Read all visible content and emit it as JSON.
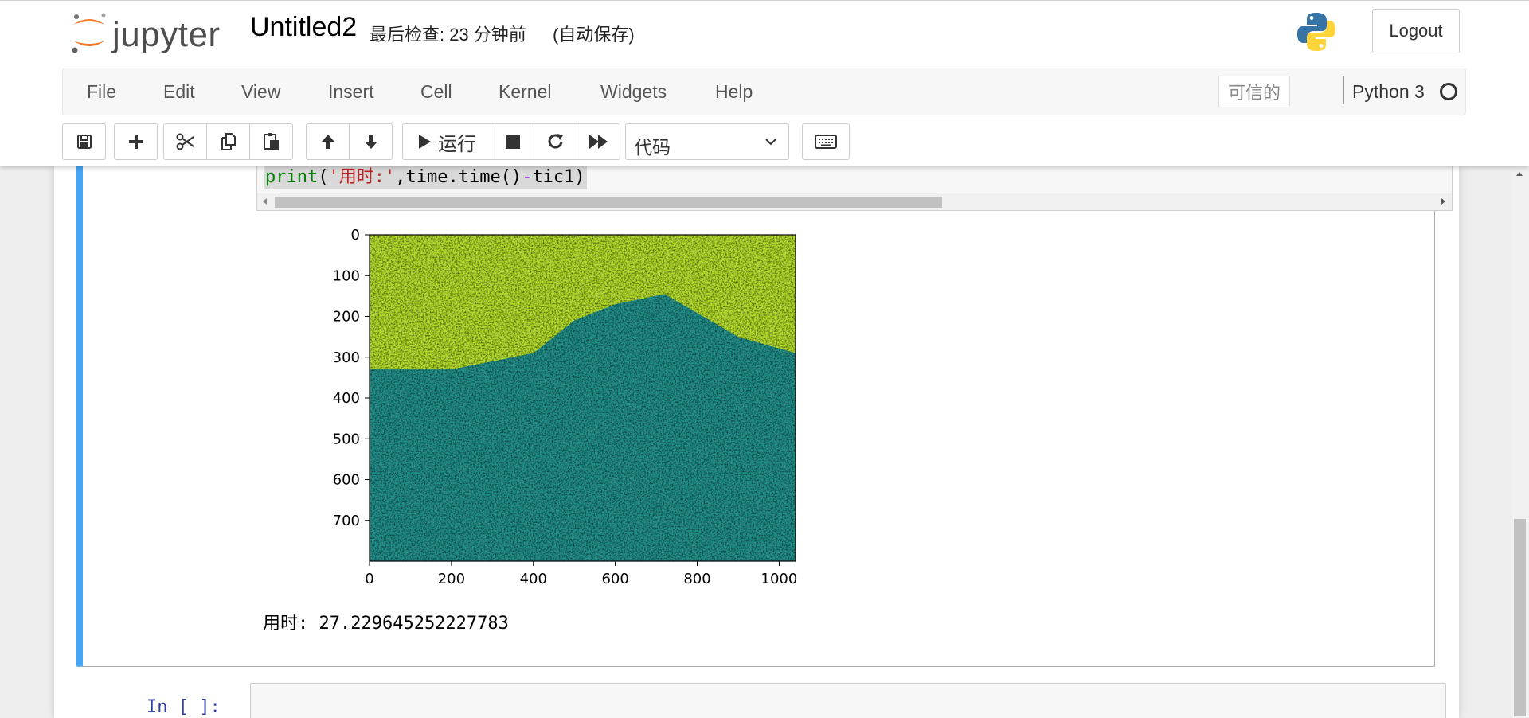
{
  "header": {
    "logo_text": "jupyter",
    "notebook_title": "Untitled2",
    "checkpoint": "最后检查: 23 分钟前",
    "autosave": "(自动保存)",
    "logout_label": "Logout"
  },
  "menu": {
    "items": [
      "File",
      "Edit",
      "View",
      "Insert",
      "Cell",
      "Kernel",
      "Widgets",
      "Help"
    ],
    "trusted": "可信的",
    "kernel_name": "Python 3"
  },
  "toolbar": {
    "run_label": "运行",
    "cell_type": "代码"
  },
  "cell": {
    "code_tokens": [
      "print",
      "(",
      "'用时:'",
      ",time.time()",
      "-",
      "tic1)"
    ],
    "output_text": "用时: 27.229645252227783"
  },
  "next_cell": {
    "prompt": "In [ ]:"
  },
  "colors": {
    "selected_cell_bar": "#42a5f5",
    "prompt_blue": "#303f9f",
    "viridis_yellow": "#fde725",
    "viridis_teal": "#21918c",
    "viridis_navy": "#3b528b"
  },
  "chart_data": {
    "type": "heatmap",
    "colormap": "viridis",
    "x_ticks": [
      "0",
      "200",
      "400",
      "600",
      "800",
      "1000"
    ],
    "y_ticks": [
      "0",
      "100",
      "200",
      "300",
      "400",
      "500",
      "600",
      "700"
    ],
    "xlim": [
      0,
      1040
    ],
    "ylim": [
      800,
      0
    ],
    "description_values": {
      "ridge_profile": [
        [
          0,
          330
        ],
        [
          200,
          330
        ],
        [
          400,
          290
        ],
        [
          500,
          210
        ],
        [
          600,
          170
        ],
        [
          720,
          145
        ],
        [
          900,
          250
        ],
        [
          1040,
          290
        ]
      ]
    }
  }
}
